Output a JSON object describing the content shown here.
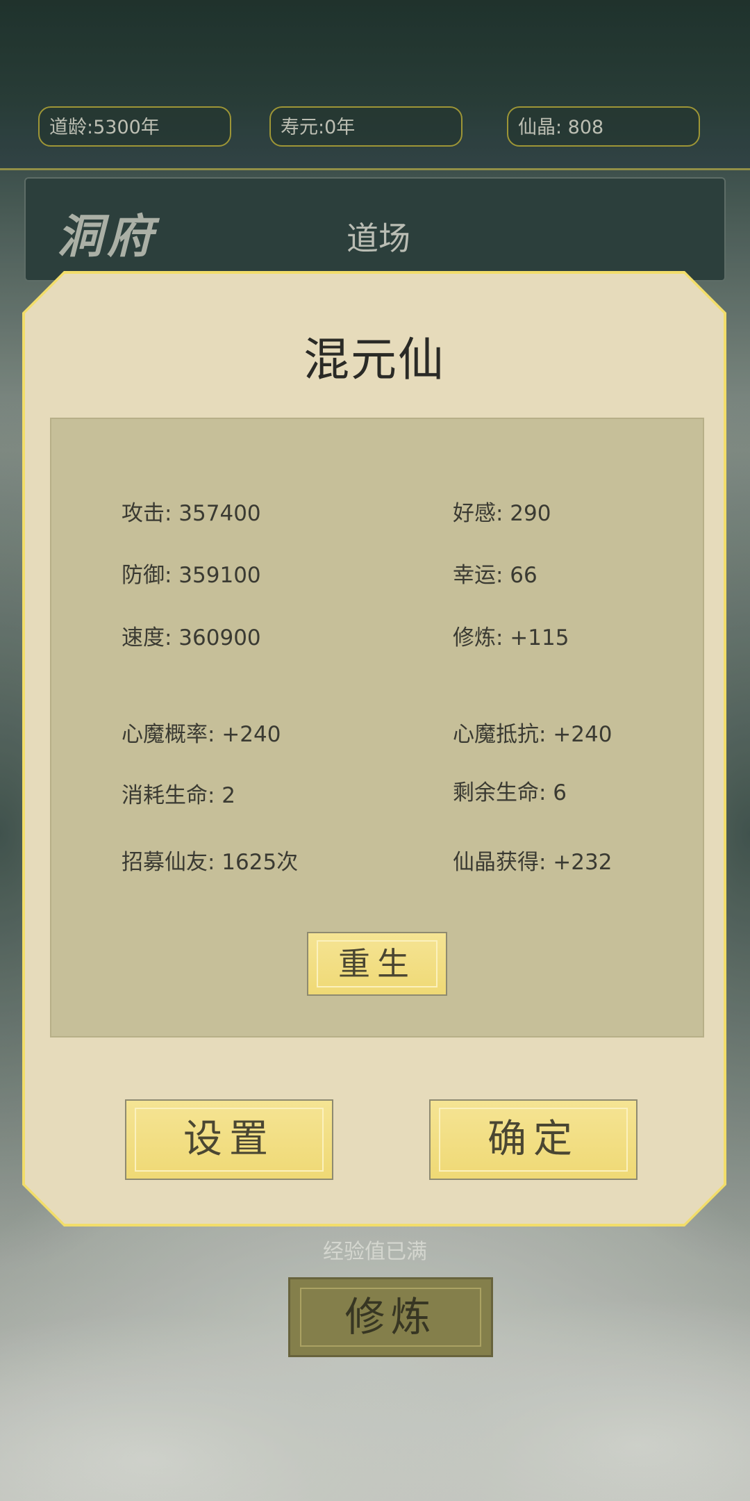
{
  "header": {
    "dao_age": "道龄:5300年",
    "lifespan": "寿元:0年",
    "crystals": "仙晶: 808"
  },
  "nav": {
    "cave_label": "洞府",
    "dojo_label": "道场"
  },
  "background": {
    "exp_status": "经验值已满",
    "cultivate_label": "修炼"
  },
  "modal": {
    "title": "混元仙",
    "stats_left": [
      "攻击: 357400",
      "防御: 359100",
      "速度: 360900",
      "心魔概率: +240",
      "消耗生命: 2",
      "招募仙友: 1625次"
    ],
    "stats_right": [
      "好感: 290",
      "幸运: 66",
      "修炼: +115",
      "心魔抵抗: +240",
      "剩余生命: 6",
      "仙晶获得: +232"
    ],
    "reborn_label": "重生",
    "settings_label": "设置",
    "confirm_label": "确定"
  },
  "colors": {
    "modal_border": "#f2dd6a",
    "modal_bg": "#e6dbbb",
    "stats_bg": "#c6bf99",
    "button_gold": "#efd975"
  }
}
